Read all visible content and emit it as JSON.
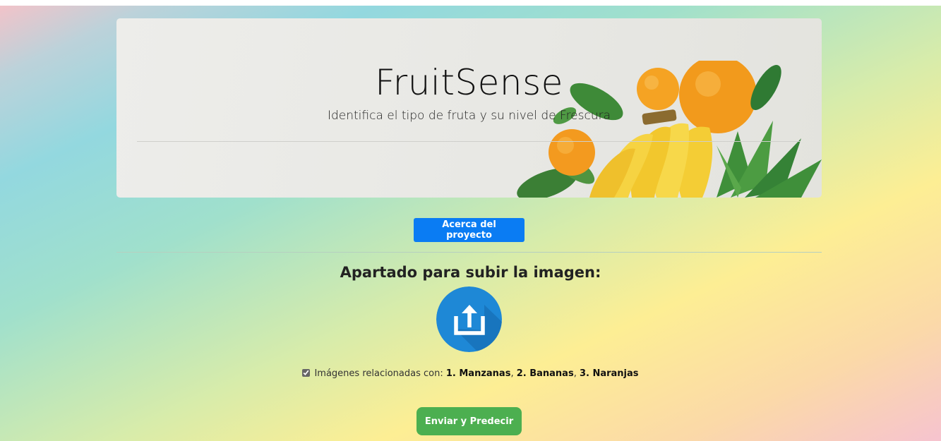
{
  "hero": {
    "title": "FruitSense",
    "subtitle": "Identifica el tipo de fruta y su nivel de Frescura"
  },
  "about_button": "Acerca del proyecto",
  "upload": {
    "heading": "Apartado para subir la imagen:",
    "icon": "upload-icon"
  },
  "related": {
    "checked": true,
    "prefix": "Imágenes relacionadas con: ",
    "item1": "1. Manzanas",
    "sep1": ", ",
    "item2": "2. Bananas",
    "sep2": ", ",
    "item3": "3. Naranjas"
  },
  "submit_button": "Enviar y Predecir",
  "colors": {
    "primary": "#0a7cf3",
    "success": "#4caf50",
    "upload_circle": "#1e88d6"
  }
}
